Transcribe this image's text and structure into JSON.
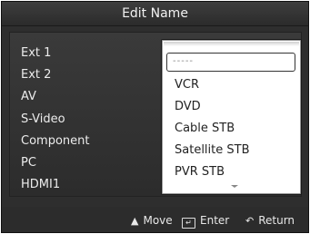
{
  "title": "Edit Name",
  "sources": [
    {
      "label": "Ext 1"
    },
    {
      "label": "Ext 2"
    },
    {
      "label": "AV"
    },
    {
      "label": "S-Video"
    },
    {
      "label": "Component"
    },
    {
      "label": "PC"
    },
    {
      "label": "HDMI1"
    }
  ],
  "colon": ":",
  "dropdown": {
    "selected_value": "-----",
    "options": [
      "VCR",
      "DVD",
      "Cable STB",
      "Satellite STB",
      "PVR STB"
    ]
  },
  "footer": {
    "move_icon": "updown-arrow-icon",
    "move_label": "Move",
    "enter_icon": "enter-icon",
    "enter_label": "Enter",
    "return_icon": "return-icon",
    "return_label": "Return"
  }
}
